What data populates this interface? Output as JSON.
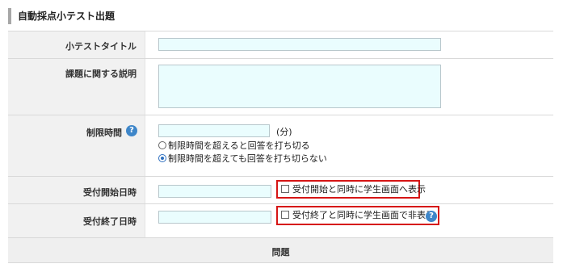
{
  "section_title": "自動採点小テスト出題",
  "fields": {
    "quiz_title": {
      "label": "小テストタイトル",
      "value": ""
    },
    "description": {
      "label": "課題に関する説明",
      "value": ""
    },
    "time_limit": {
      "label": "制限時間",
      "value": "",
      "unit": "(分)",
      "help_icon": "?",
      "options": [
        {
          "label": "制限時間を超えると回答を打ち切る",
          "checked": false
        },
        {
          "label": "制限時間を超えても回答を打ち切らない",
          "checked": true
        }
      ]
    },
    "start_datetime": {
      "label": "受付開始日時",
      "value": "",
      "checkbox_label": "受付開始と同時に学生画面へ表示",
      "checked": false
    },
    "end_datetime": {
      "label": "受付終了日時",
      "value": "",
      "checkbox_label": "受付終了と同時に学生画面で非表示",
      "checked": false,
      "help_icon": "?"
    }
  },
  "questions_header": "問題",
  "colors": {
    "input_bg": "#eafdfe",
    "label_bg": "#f1f1f1",
    "highlight_border": "#d61515",
    "help_icon": "#3e86c9"
  }
}
